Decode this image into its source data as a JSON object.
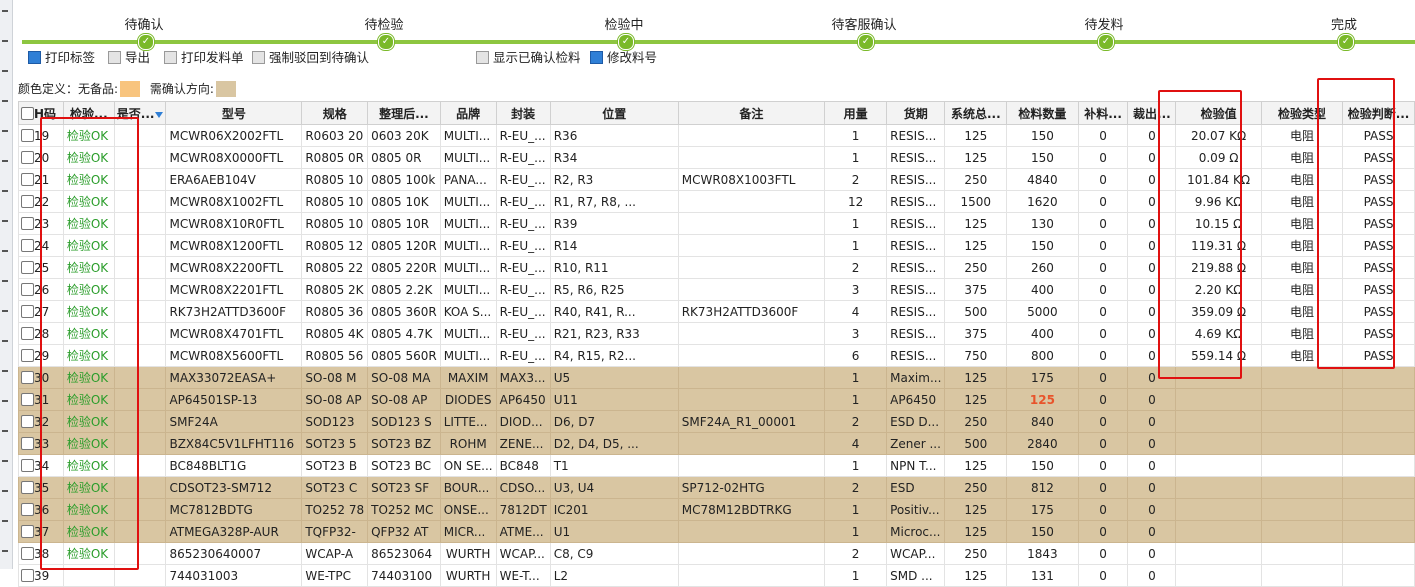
{
  "progress": {
    "steps": [
      "待确认",
      "待检验",
      "检验中",
      "待客服确认",
      "待发料",
      "完成"
    ]
  },
  "toolbar": {
    "print_label": "打印标签",
    "export": "导出",
    "print_issue": "打印发料单",
    "force_back": "强制驳回到待确认",
    "show_confirmed": "显示已确认检料",
    "modify_material": "修改料号"
  },
  "colordef": {
    "label": "颜色定义：",
    "no_stock": "无备品:",
    "no_stock_color": "#f8c47e",
    "need_confirm": "需确认方向:",
    "need_confirm_color": "#d9c6a2"
  },
  "table": {
    "headers": [
      "H码",
      "检验...",
      "是否...",
      "型号",
      "规格",
      "整理后...",
      "品牌",
      "封装",
      "位置",
      "备注",
      "用量",
      "货期",
      "系统总...",
      "检料数量",
      "补料...",
      "裁出...",
      "检验值",
      "检验类型",
      "检验判断..."
    ],
    "rows": [
      [
        "19",
        "检验OK",
        "",
        "MCWR06X2002FTL",
        "R0603 20",
        "0603 20K",
        "MULTI...",
        "R-EU_...",
        "R36",
        "",
        "1",
        "RESIS...",
        "125",
        "150",
        "0",
        "0",
        "20.07 KΩ",
        "电阻",
        "PASS"
      ],
      [
        "20",
        "检验OK",
        "",
        "MCWR08X0000FTL",
        "R0805 0R",
        "0805 0R",
        "MULTI...",
        "R-EU_...",
        "R34",
        "",
        "1",
        "RESIS...",
        "125",
        "150",
        "0",
        "0",
        "0.09 Ω",
        "电阻",
        "PASS"
      ],
      [
        "21",
        "检验OK",
        "",
        "ERA6AEB104V",
        "R0805 10",
        "0805 100k",
        "PANA...",
        "R-EU_...",
        "R2, R3",
        "MCWR08X1003FTL",
        "2",
        "RESIS...",
        "250",
        "4840",
        "0",
        "0",
        "101.84 KΩ",
        "电阻",
        "PASS"
      ],
      [
        "22",
        "检验OK",
        "",
        "MCWR08X1002FTL",
        "R0805 10",
        "0805 10K",
        "MULTI...",
        "R-EU_...",
        "R1, R7, R8, ...",
        "",
        "12",
        "RESIS...",
        "1500",
        "1620",
        "0",
        "0",
        "9.96 KΩ",
        "电阻",
        "PASS"
      ],
      [
        "23",
        "检验OK",
        "",
        "MCWR08X10R0FTL",
        "R0805 10",
        "0805 10R",
        "MULTI...",
        "R-EU_...",
        "R39",
        "",
        "1",
        "RESIS...",
        "125",
        "130",
        "0",
        "0",
        "10.15 Ω",
        "电阻",
        "PASS"
      ],
      [
        "24",
        "检验OK",
        "",
        "MCWR08X1200FTL",
        "R0805 12",
        "0805 120R",
        "MULTI...",
        "R-EU_...",
        "R14",
        "",
        "1",
        "RESIS...",
        "125",
        "150",
        "0",
        "0",
        "119.31 Ω",
        "电阻",
        "PASS"
      ],
      [
        "25",
        "检验OK",
        "",
        "MCWR08X2200FTL",
        "R0805 22",
        "0805 220R",
        "MULTI...",
        "R-EU_...",
        "R10, R11",
        "",
        "2",
        "RESIS...",
        "250",
        "260",
        "0",
        "0",
        "219.88 Ω",
        "电阻",
        "PASS"
      ],
      [
        "26",
        "检验OK",
        "",
        "MCWR08X2201FTL",
        "R0805 2K",
        "0805 2.2K",
        "MULTI...",
        "R-EU_...",
        "R5, R6, R25",
        "",
        "3",
        "RESIS...",
        "375",
        "400",
        "0",
        "0",
        "2.20 KΩ",
        "电阻",
        "PASS"
      ],
      [
        "27",
        "检验OK",
        "",
        "RK73H2ATTD3600F",
        "R0805 36",
        "0805 360R",
        "KOA S...",
        "R-EU_...",
        "R40, R41, R...",
        "RK73H2ATTD3600F",
        "4",
        "RESIS...",
        "500",
        "5000",
        "0",
        "0",
        "359.09 Ω",
        "电阻",
        "PASS"
      ],
      [
        "28",
        "检验OK",
        "",
        "MCWR08X4701FTL",
        "R0805 4K",
        "0805 4.7K",
        "MULTI...",
        "R-EU_...",
        "R21, R23, R33",
        "",
        "3",
        "RESIS...",
        "375",
        "400",
        "0",
        "0",
        "4.69 KΩ",
        "电阻",
        "PASS"
      ],
      [
        "29",
        "检验OK",
        "",
        "MCWR08X5600FTL",
        "R0805 56",
        "0805 560R",
        "MULTI...",
        "R-EU_...",
        "R4, R15, R2...",
        "",
        "6",
        "RESIS...",
        "750",
        "800",
        "0",
        "0",
        "559.14 Ω",
        "电阻",
        "PASS"
      ],
      [
        "30",
        "检验OK",
        "",
        "MAX33072EASA+",
        "SO-08 M",
        "SO-08 MA",
        "MAXIM",
        "MAX3...",
        "U5",
        "",
        "1",
        "Maxim...",
        "125",
        "175",
        "0",
        "0",
        "",
        "",
        ""
      ],
      [
        "31",
        "检验OK",
        "",
        "AP64501SP-13",
        "SO-08 AP",
        "SO-08 AP",
        "DIODES",
        "AP6450",
        "U11",
        "",
        "1",
        "AP6450",
        "125",
        "125",
        "0",
        "0",
        "",
        "",
        ""
      ],
      [
        "32",
        "检验OK",
        "",
        "SMF24A",
        "SOD123",
        "SOD123 S",
        "LITTE...",
        "DIOD...",
        "D6, D7",
        "SMF24A_R1_00001",
        "2",
        "ESD D...",
        "250",
        "840",
        "0",
        "0",
        "",
        "",
        ""
      ],
      [
        "33",
        "检验OK",
        "",
        "BZX84C5V1LFHT116",
        "SOT23 5",
        "SOT23 BZ",
        "ROHM",
        "ZENE...",
        "D2, D4, D5, ...",
        "",
        "4",
        "Zener ...",
        "500",
        "2840",
        "0",
        "0",
        "",
        "",
        ""
      ],
      [
        "34",
        "检验OK",
        "",
        "BC848BLT1G",
        "SOT23 B",
        "SOT23 BC",
        "ON SE...",
        "BC848",
        "T1",
        "",
        "1",
        "NPN T...",
        "125",
        "150",
        "0",
        "0",
        "",
        "",
        ""
      ],
      [
        "35",
        "检验OK",
        "",
        "CDSOT23-SM712",
        "SOT23 C",
        "SOT23 SF",
        "BOUR...",
        "CDSO...",
        "U3, U4",
        "SP712-02HTG",
        "2",
        "ESD",
        "250",
        "812",
        "0",
        "0",
        "",
        "",
        ""
      ],
      [
        "36",
        "检验OK",
        "",
        "MC7812BDTG",
        "TO252 78",
        "TO252 MC",
        "ONSE...",
        "7812DT",
        "IC201",
        "MC78M12BDTRKG",
        "1",
        "Positiv...",
        "125",
        "175",
        "0",
        "0",
        "",
        "",
        ""
      ],
      [
        "37",
        "检验OK",
        "",
        "ATMEGA328P-AUR",
        "TQFP32-",
        "QFP32 AT",
        "MICR...",
        "ATME...",
        "U1",
        "",
        "1",
        "Microc...",
        "125",
        "150",
        "0",
        "0",
        "",
        "",
        ""
      ],
      [
        "38",
        "检验OK",
        "",
        "865230640007",
        "WCAP-A",
        "86523064",
        "WURTH",
        "WCAP...",
        "C8, C9",
        "",
        "2",
        "WCAP...",
        "250",
        "1843",
        "0",
        "0",
        "",
        "",
        ""
      ],
      [
        "39",
        "",
        "",
        "744031003",
        "WE-TPC",
        "74403100",
        "WURTH",
        "WE-T...",
        "L2",
        "",
        "1",
        "SMD ...",
        "125",
        "131",
        "0",
        "0",
        "",
        "",
        ""
      ]
    ]
  }
}
